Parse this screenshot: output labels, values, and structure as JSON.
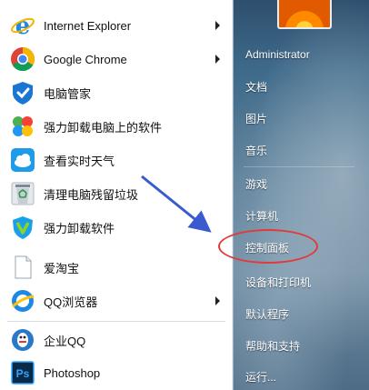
{
  "programs": [
    {
      "label": "Internet Explorer",
      "icon": "internet-explorer-icon",
      "has_submenu": true
    },
    {
      "label": "Google Chrome",
      "icon": "google-chrome-icon",
      "has_submenu": true
    },
    {
      "label": "电脑管家",
      "icon": "pc-manager-icon",
      "has_submenu": false
    },
    {
      "label": "强力卸载电脑上的软件",
      "icon": "uninstaller-clover-icon",
      "has_submenu": false
    },
    {
      "label": "查看实时天气",
      "icon": "weather-icon",
      "has_submenu": false
    },
    {
      "label": "清理电脑残留垃圾",
      "icon": "recycle-bin-icon",
      "has_submenu": false
    },
    {
      "label": "强力卸载软件",
      "icon": "uninstall-software-icon",
      "has_submenu": false
    },
    {
      "label": "爱淘宝",
      "icon": "document-icon",
      "has_submenu": false
    },
    {
      "label": "QQ浏览器",
      "icon": "qq-browser-icon",
      "has_submenu": true
    },
    {
      "label": "企业QQ",
      "icon": "enterprise-qq-icon",
      "has_submenu": false
    },
    {
      "label": "Photoshop",
      "icon": "photoshop-icon",
      "has_submenu": false
    }
  ],
  "places": [
    {
      "label": "Administrator"
    },
    {
      "label": "文档"
    },
    {
      "label": "图片"
    },
    {
      "label": "音乐"
    },
    {
      "label": "游戏"
    },
    {
      "label": "计算机"
    },
    {
      "label": "控制面板",
      "highlighted": true
    },
    {
      "label": "设备和打印机"
    },
    {
      "label": "默认程序"
    },
    {
      "label": "帮助和支持"
    },
    {
      "label": "运行..."
    }
  ],
  "colors": {
    "annotation_red": "#e13a3a",
    "annotation_arrow_blue": "#3a5bd0"
  }
}
